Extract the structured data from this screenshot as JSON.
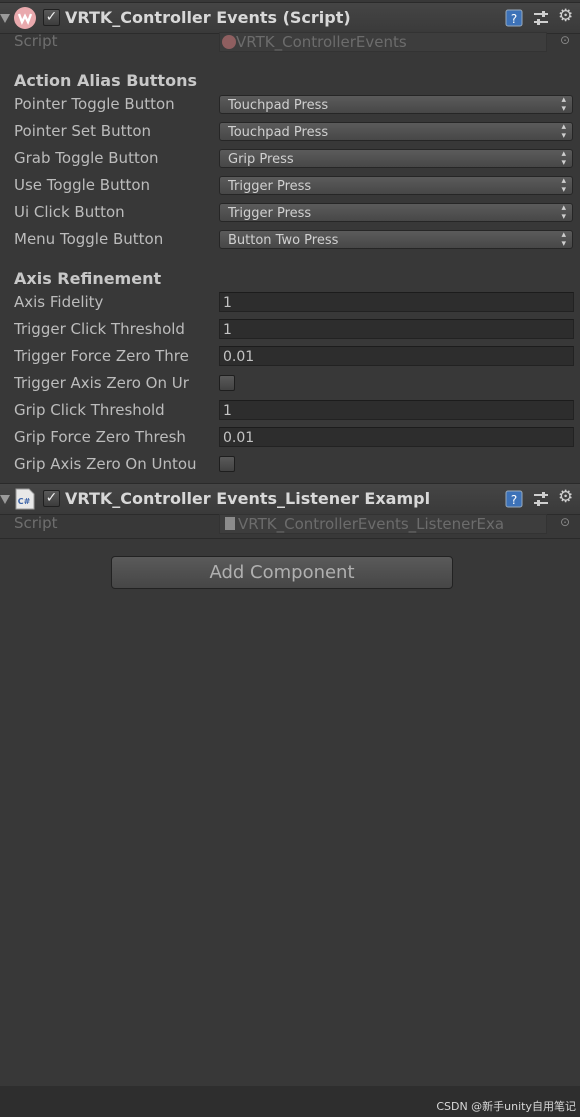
{
  "component1": {
    "title": "VRTK_Controller Events (Script)",
    "enabled": true,
    "script_label": "Script",
    "script_value": "VRTK_ControllerEvents",
    "action_section": "Action Alias Buttons",
    "action_rows": [
      {
        "label": "Pointer Toggle Button",
        "value": "Touchpad Press"
      },
      {
        "label": "Pointer Set Button",
        "value": "Touchpad Press"
      },
      {
        "label": "Grab Toggle Button",
        "value": "Grip Press"
      },
      {
        "label": "Use Toggle Button",
        "value": "Trigger Press"
      },
      {
        "label": "Ui Click Button",
        "value": "Trigger Press"
      },
      {
        "label": "Menu Toggle Button",
        "value": "Button Two Press"
      }
    ],
    "axis_section": "Axis Refinement",
    "axis_rows": [
      {
        "label": "Axis Fidelity",
        "value": "1",
        "kind": "field"
      },
      {
        "label": "Trigger Click Threshold",
        "value": "1",
        "kind": "field"
      },
      {
        "label": "Trigger Force Zero Thre",
        "value": "0.01",
        "kind": "field"
      },
      {
        "label": "Trigger Axis Zero On Ur",
        "value": "",
        "kind": "checkbox"
      },
      {
        "label": "Grip Click Threshold",
        "value": "1",
        "kind": "field"
      },
      {
        "label": "Grip Force Zero Thresh",
        "value": "0.01",
        "kind": "field"
      },
      {
        "label": "Grip Axis Zero On Untou",
        "value": "",
        "kind": "checkbox"
      }
    ]
  },
  "component2": {
    "title": "VRTK_Controller Events_Listener Exampl",
    "enabled": true,
    "script_label": "Script",
    "script_value": "VRTK_ControllerEvents_ListenerExa"
  },
  "add_component_label": "Add Component",
  "watermark": "CSDN @新手unity自用笔记",
  "icons": [
    "foldout-arrow-icon",
    "vrtk-logo-icon",
    "csharp-script-icon",
    "help-book-icon",
    "preset-sliders-icon",
    "gear-icon",
    "object-picker-icon"
  ]
}
